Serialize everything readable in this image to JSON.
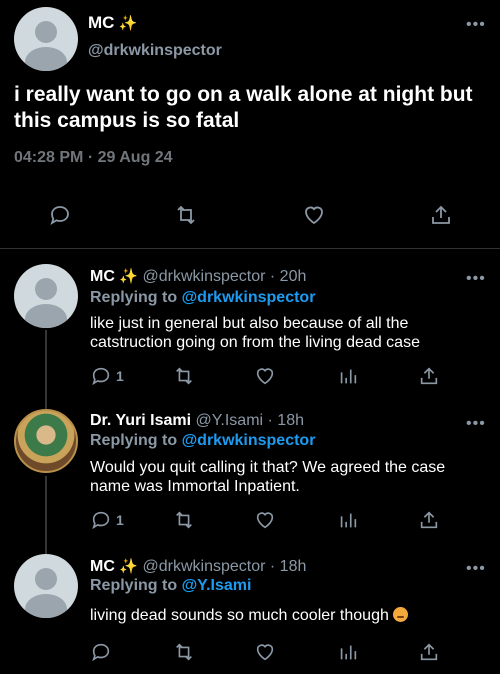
{
  "main": {
    "name": "MC",
    "handle": "@drkwkinspector",
    "text": "i really want to go on a walk alone at night but this campus is so fatal",
    "timestamp": "04:28 PM · 29 Aug 24"
  },
  "replies": [
    {
      "name": "MC",
      "handle": "@drkwkinspector",
      "time": "· 20h",
      "replying_prefix": "Replying to ",
      "replying_to": "@drkwkinspector",
      "text": "like just in general but also because of all the catstruction going on from the living dead case",
      "reply_count": "1"
    },
    {
      "name": "Dr. Yuri Isami",
      "handle": "@Y.Isami",
      "time": "· 18h",
      "replying_prefix": "Replying to ",
      "replying_to": "@drkwkinspector",
      "text": "Would you quit calling it that? We agreed the case name was Immortal Inpatient.",
      "reply_count": "1"
    },
    {
      "name": "MC",
      "handle": "@drkwkinspector",
      "time": "· 18h",
      "replying_prefix": "Replying to ",
      "replying_to": "@Y.Isami",
      "text": "living dead sounds so much cooler though",
      "reply_count": ""
    }
  ],
  "icons": {
    "reply": "reply-icon",
    "retweet": "retweet-icon",
    "like": "heart-icon",
    "views": "analytics-icon",
    "share": "share-icon",
    "more": "more-icon",
    "sparkle": "sparkles-icon",
    "emoji": "pensive-face-emoji"
  },
  "colors": {
    "background": "#000000",
    "link": "#1d9bf0",
    "muted": "#71767b",
    "divider": "#2f3336"
  }
}
